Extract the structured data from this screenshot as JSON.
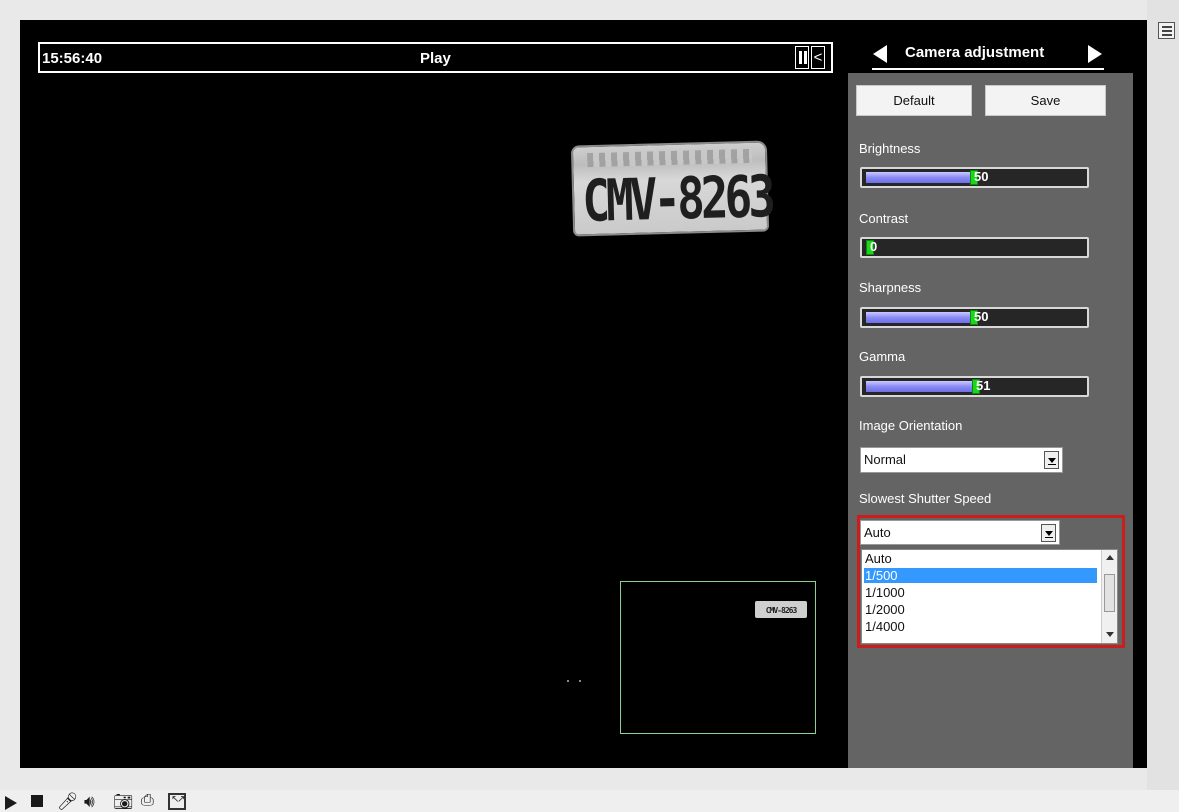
{
  "video": {
    "time": "15:56:40",
    "status": "Play",
    "collapse_glyph": "<"
  },
  "plate": {
    "text": "CMV-8263",
    "thumb_text": "CMV-8263"
  },
  "panel": {
    "title": "Camera adjustment",
    "default_label": "Default",
    "save_label": "Save",
    "brightness": {
      "label": "Brightness",
      "value": "50",
      "level": 0.5
    },
    "contrast": {
      "label": "Contrast",
      "value": "0",
      "level": 0.0
    },
    "sharpness": {
      "label": "Sharpness",
      "value": "50",
      "level": 0.5
    },
    "gamma": {
      "label": "Gamma",
      "value": "51",
      "level": 0.51
    },
    "orientation": {
      "label": "Image Orientation",
      "selected": "Normal"
    },
    "shutter": {
      "label": "Slowest Shutter Speed",
      "selected": "Auto",
      "options": [
        "Auto",
        "1/500",
        "1/1000",
        "1/2000",
        "1/4000"
      ],
      "highlighted": "1/500"
    }
  },
  "toolbar": {
    "icons": [
      "play-icon",
      "stop-icon",
      "microphone-icon",
      "speaker-icon",
      "snapshot-icon",
      "record-icon",
      "fullscreen-icon"
    ]
  },
  "colors": {
    "panel_bg": "#646464",
    "slider_fill": "#8b8bf5",
    "slider_knob": "#1cd61c",
    "highlight_border": "#cc1d1d",
    "list_selection": "#3399ff"
  }
}
